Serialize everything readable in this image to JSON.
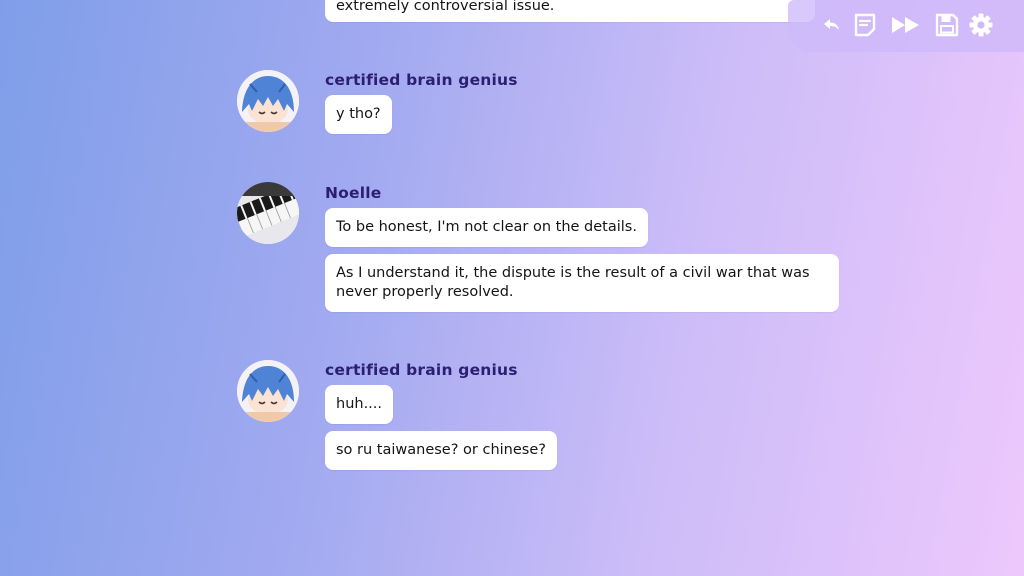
{
  "toolbar": {
    "back_icon": "back-arrow-icon",
    "log_icon": "history-log-icon",
    "skip_icon": "fast-forward-icon",
    "save_icon": "save-icon",
    "settings_icon": "gear-icon",
    "icon_color": "#ffffff"
  },
  "messages": {
    "clipped_text": "extremely controversial issue.",
    "group1": {
      "sender": "certified brain genius",
      "lines": [
        "y tho?"
      ]
    },
    "group2": {
      "sender": "Noelle",
      "lines": [
        "To be honest, I'm not clear on the details.",
        "As I understand it, the dispute is the result of a civil war that was never properly resolved."
      ]
    },
    "group3": {
      "sender": "certified brain genius",
      "lines": [
        "huh....",
        "so ru taiwanese? or chinese?"
      ]
    }
  },
  "colors": {
    "sender_name": "#2c1f72",
    "bubble": "#ffffff",
    "bg_left": "#7f9ee9",
    "bg_right": "#edc8fc"
  }
}
